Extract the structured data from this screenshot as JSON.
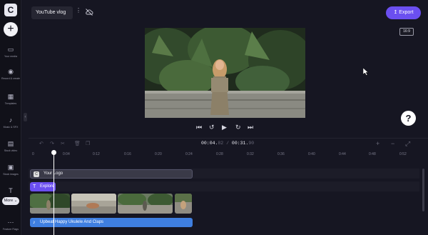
{
  "app": {
    "logo_letter": "C"
  },
  "header": {
    "title": "YouTube vlog",
    "kebab": "⋮",
    "export_label": "Export",
    "export_icon": "↥",
    "aspect_ratio": "16:9",
    "accent": "#6b4ff0"
  },
  "sidebar": {
    "add": "+",
    "items": [
      {
        "label": "Your media",
        "icon": "folder-icon",
        "glyph": "▭"
      },
      {
        "label": "Record & create",
        "icon": "record-icon",
        "glyph": "◉"
      },
      {
        "label": "Templates",
        "icon": "templates-icon",
        "glyph": "▦"
      },
      {
        "label": "Music & SFX",
        "icon": "music-icon",
        "glyph": "♪"
      },
      {
        "label": "Stock video",
        "icon": "film-icon",
        "glyph": "▤"
      },
      {
        "label": "Stock images",
        "icon": "image-icon",
        "glyph": "▣"
      },
      {
        "label": "Text",
        "icon": "text-icon",
        "glyph": "T"
      },
      {
        "label": "Feature Flags",
        "icon": "flags-icon",
        "glyph": "⋯"
      }
    ],
    "more_label": "More ⌄",
    "collapse": "‹"
  },
  "preview": {
    "help": "?",
    "controls": {
      "skip_back": "⏮",
      "rewind": "↺",
      "play": "▶",
      "forward": "↻",
      "skip_forward": "⏭"
    }
  },
  "timeline": {
    "tools": {
      "undo": "↶",
      "redo": "↷",
      "cut": "✂",
      "delete": "🗑",
      "duplicate": "❐"
    },
    "timecode_current_main": "00:04.",
    "timecode_current_frac": "82",
    "timecode_sep": " / ",
    "timecode_total_main": "00:31.",
    "timecode_total_frac": "90",
    "zoom": {
      "in": "+",
      "out": "−",
      "fit": "⤢"
    },
    "ruler": [
      "0",
      "0:04",
      "0:12",
      "0:16",
      "0:20",
      "0:24",
      "0:28",
      "0:32",
      "0:36",
      "0:40",
      "0:44",
      "0:48",
      "0:52",
      "0:56",
      "1 MIN",
      "1:04",
      "1:08",
      "1:12"
    ],
    "logo_track_label": "Your Logo",
    "text_track_label": "Explore",
    "audio_track_label": "Upbeat Happy Ukulele And Claps",
    "audio_color": "#3f7fe0"
  }
}
